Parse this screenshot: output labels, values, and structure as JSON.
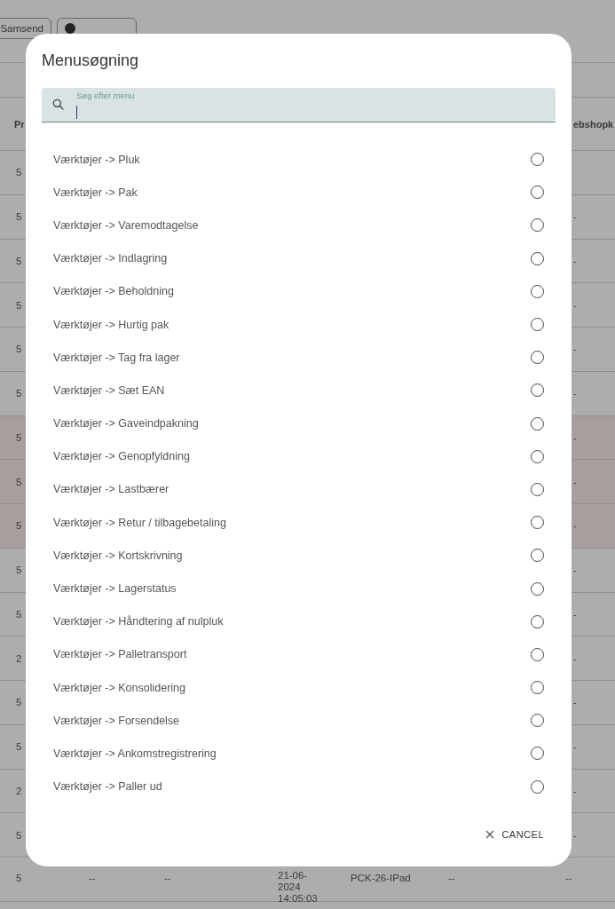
{
  "toolbar": {
    "buttons": [
      {
        "kind": "text",
        "label": "Samsend"
      },
      {
        "kind": "icon"
      }
    ]
  },
  "table": {
    "header": {
      "column_1": "Pr",
      "column_7": "ebshopk"
    },
    "rows": [
      {
        "column_1": "5",
        "highlighted": false
      },
      {
        "column_1": "5",
        "column_7": "-",
        "highlighted": false
      },
      {
        "column_1": "5",
        "column_7": "-",
        "highlighted": false
      },
      {
        "column_1": "5",
        "column_7": "-",
        "highlighted": false
      },
      {
        "column_1": "5",
        "column_7": "-",
        "highlighted": false
      },
      {
        "column_1": "5",
        "column_7": "-",
        "highlighted": false
      },
      {
        "column_1": "5",
        "column_7": "-",
        "highlighted": true
      },
      {
        "column_1": "5",
        "column_7": "-",
        "highlighted": true
      },
      {
        "column_1": "5",
        "column_7": "-",
        "highlighted": true
      },
      {
        "column_1": "5",
        "column_7": "-",
        "highlighted": false
      },
      {
        "column_1": "5",
        "column_7": "-",
        "highlighted": false
      },
      {
        "column_1": "2",
        "column_7": "-",
        "highlighted": false
      },
      {
        "column_1": "5",
        "column_7": "-",
        "highlighted": false
      },
      {
        "column_1": "5",
        "column_7": "-",
        "highlighted": false
      },
      {
        "column_1": "2",
        "column_7": "-",
        "highlighted": false
      },
      {
        "column_1": "5",
        "column_7": "-",
        "highlighted": false
      },
      {
        "column_1": "5",
        "column_2": "--",
        "column_3": "--",
        "column_4": "21-06-2024 14:05:03",
        "column_5": "PCK-26-IPad",
        "column_6": "--",
        "column_7": "--",
        "highlighted": false
      }
    ]
  },
  "dialog": {
    "title": "Menusøgning",
    "search": {
      "label": "Søg efter menu",
      "focused": true
    },
    "items": [
      {
        "label": "Værktøjer -> Pluk",
        "selected": false
      },
      {
        "label": "Værktøjer -> Pak",
        "selected": false
      },
      {
        "label": "Værktøjer -> Varemodtagelse",
        "selected": false
      },
      {
        "label": "Værktøjer -> Indlagring",
        "selected": false
      },
      {
        "label": "Værktøjer -> Beholdning",
        "selected": false
      },
      {
        "label": "Værktøjer -> Hurtig pak",
        "selected": false
      },
      {
        "label": "Værktøjer -> Tag fra lager",
        "selected": false
      },
      {
        "label": "Værktøjer -> Sæt EAN",
        "selected": false
      },
      {
        "label": "Værktøjer -> Gaveindpakning",
        "selected": false
      },
      {
        "label": "Værktøjer -> Genopfyldning",
        "selected": false
      },
      {
        "label": "Værktøjer -> Lastbærer",
        "selected": false
      },
      {
        "label": "Værktøjer -> Retur / tilbagebetaling",
        "selected": false
      },
      {
        "label": "Værktøjer -> Kortskrivning",
        "selected": false
      },
      {
        "label": "Værktøjer -> Lagerstatus",
        "selected": false
      },
      {
        "label": "Værktøjer -> Håndtering af nulpluk",
        "selected": false
      },
      {
        "label": "Værktøjer -> Palletransport",
        "selected": false
      },
      {
        "label": "Værktøjer -> Konsolidering",
        "selected": false
      },
      {
        "label": "Værktøjer -> Forsendelse",
        "selected": false
      },
      {
        "label": "Værktøjer -> Ankomstregistrering",
        "selected": false
      },
      {
        "label": "Værktøjer -> Paller ud",
        "selected": false
      }
    ],
    "cancel": "CANCEL"
  }
}
